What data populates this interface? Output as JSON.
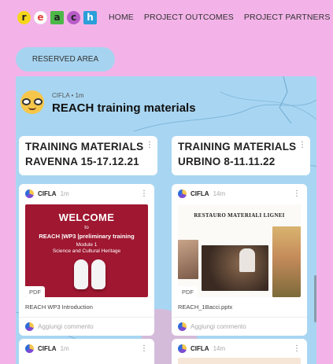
{
  "logo": {
    "letters": [
      "r",
      "e",
      "a",
      "c",
      "h"
    ]
  },
  "nav": {
    "items": [
      "HOME",
      "PROJECT OUTCOMES",
      "PROJECT PARTNERS"
    ]
  },
  "reserved_area": {
    "label": "RESERVED AREA"
  },
  "board": {
    "author": "CIFLA • 1m",
    "title": "REACH training materials",
    "columns": [
      {
        "title_line1": "TRAINING MATERIALS",
        "title_line2": "RAVENNA 15-17.12.21"
      },
      {
        "title_line1": "TRAINING MATERIALS",
        "title_line2": "URBINO 8-11.11.22"
      }
    ],
    "posts": [
      {
        "author": "CIFLA",
        "time": "1m",
        "thumb": {
          "type": "PDF",
          "line1": "WELCOME",
          "line2": "to",
          "line3": "REACH |WP3 |preliminary training",
          "line4": "Module 1",
          "line5": "Science and Cultural Heritage"
        },
        "caption": "REACH WP3 Introduction",
        "comment": "Aggiungi commento"
      },
      {
        "author": "CIFLA",
        "time": "14m",
        "thumb": {
          "type": "PDF",
          "title": "RESTAURO MATERIALI LIGNEI"
        },
        "caption": "REACH_1Bacci.pptx",
        "comment": "Aggiungi commento"
      },
      {
        "author": "CIFLA",
        "time": "1m"
      },
      {
        "author": "CIFLA",
        "time": "14m"
      }
    ]
  },
  "colors": {
    "page_bg": "#f3b3e8",
    "board_bg": "#a8d6f2",
    "logo_r": "#f4d51c",
    "logo_e": "#ffffff",
    "logo_a": "#4cb848",
    "logo_c": "#b85cc8",
    "logo_h": "#2a9fd8",
    "welcome_bg": "#9f1730"
  },
  "icons": {
    "board_emoji": "nerd-face-icon",
    "avatar": "cifla-avatar-icon",
    "more": "more-vertical-icon"
  }
}
